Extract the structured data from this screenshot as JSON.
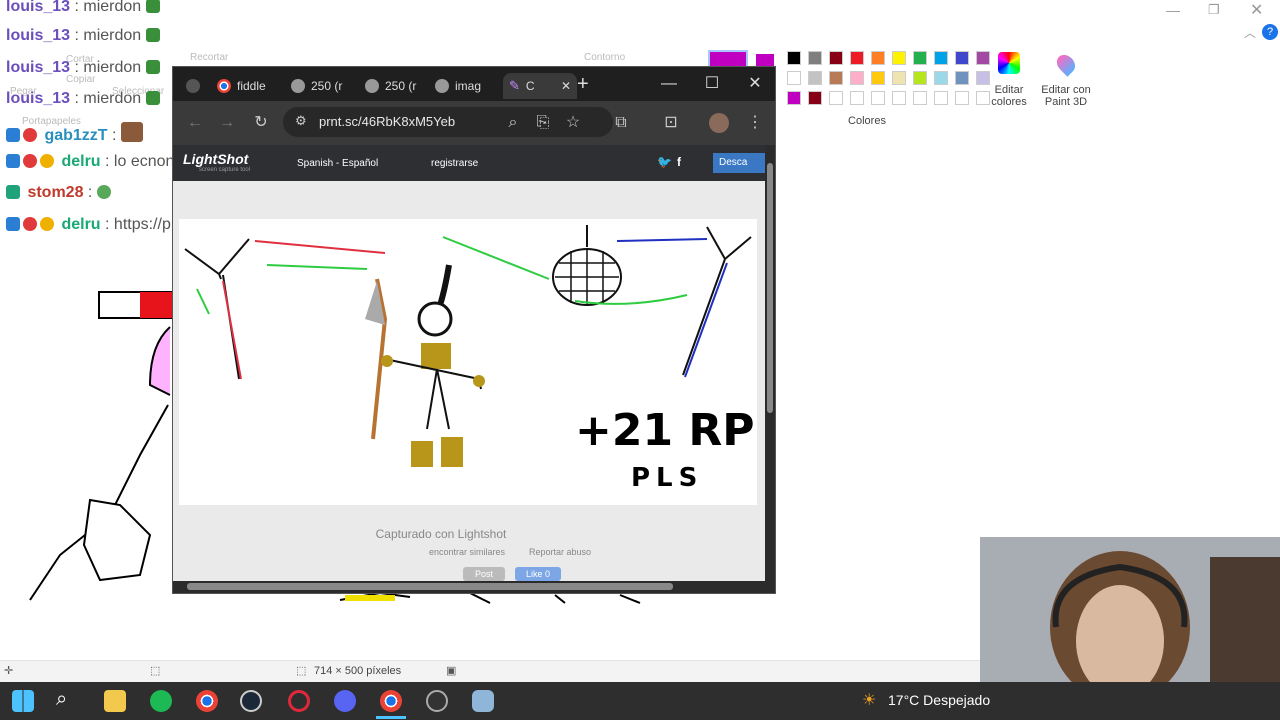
{
  "chat": [
    {
      "user": "louis_13",
      "sep": " : ",
      "msg": "mierdon"
    },
    {
      "user": "louis_13",
      "sep": " : ",
      "msg": "mierdon"
    },
    {
      "user": "louis_13",
      "sep": " : ",
      "msg": "mierdon"
    },
    {
      "user": "louis_13",
      "sep": " : ",
      "msg": "mierdon"
    },
    {
      "user": "gab1zzT",
      "sep": " :",
      "msg": ""
    },
    {
      "user": "delru",
      "sep": " : ",
      "msg": "lo ecnontre"
    },
    {
      "user": "stom28",
      "sep": " :",
      "msg": ""
    },
    {
      "user": "delru",
      "sep": " : ",
      "msg": "https://prnt.sc/46RbK8xM5Yeb"
    }
  ],
  "paint": {
    "ribbon_ghost": [
      "Recortar",
      "Cortar",
      "Copiar",
      "Pegar",
      "Seleccionar",
      "Portapapeles",
      "Contorno"
    ],
    "edit_colors": "Editar colores",
    "edit_paint3d": "Editar con Paint 3D",
    "colors_label": "Colores",
    "status_dims": "714 × 500 píxeles",
    "palette_top": [
      "#000000",
      "#7f7f7f",
      "#880015",
      "#ed1c24",
      "#ff7f27",
      "#fff200",
      "#22b14c",
      "#00a2e8",
      "#3f48cc",
      "#a349a4"
    ],
    "palette_mid": [
      "#ffffff",
      "#c3c3c3",
      "#b97a57",
      "#ffaec9",
      "#ffc90e",
      "#efe4b0",
      "#b5e61d",
      "#99d9ea",
      "#7092be",
      "#c8bfe7"
    ],
    "palette_bot": [
      "#c000c0",
      "#880015",
      "#ffffff",
      "#ffffff",
      "#ffffff",
      "#ffffff",
      "#ffffff",
      "#ffffff",
      "#ffffff",
      "#ffffff"
    ]
  },
  "browser": {
    "tabs": [
      "fiddle",
      "250 (r",
      "250 (r",
      "imag",
      "C"
    ],
    "url": "prnt.sc/46RbK8xM5Yeb",
    "lightshot": {
      "logo": "LightShot",
      "tagline": "screen capture tool",
      "language": "Spanish - Español",
      "register": "registrarse",
      "download": "Desca",
      "captured": "Capturado con Lightshot",
      "similar": "encontrar similares",
      "report": "Reportar abuso",
      "post": "Post",
      "like": "Like 0"
    },
    "drawing_text_1": "+21 RP",
    "drawing_text_2": "PLS"
  },
  "taskbar": {
    "temperature": "17°C",
    "weather": "Despejado"
  }
}
